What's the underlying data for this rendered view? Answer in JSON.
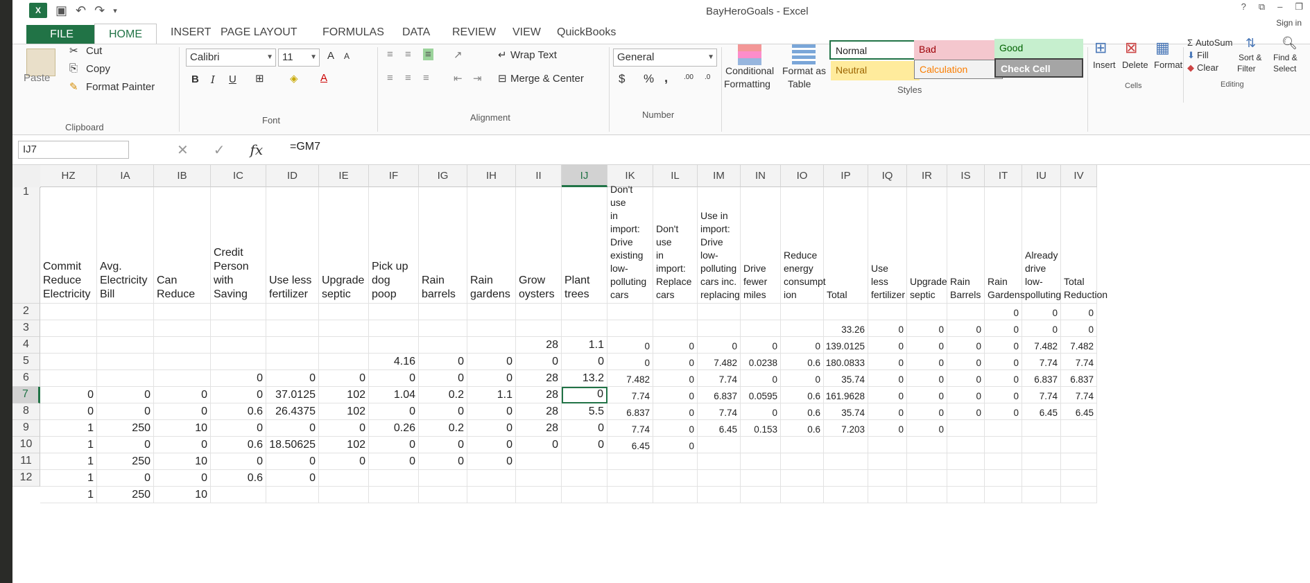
{
  "app": {
    "title": "BayHeroGoals - Excel",
    "sign_in": "Sign in",
    "logo": "X"
  },
  "tabs": [
    "FILE",
    "HOME",
    "INSERT",
    "PAGE LAYOUT",
    "FORMULAS",
    "DATA",
    "REVIEW",
    "VIEW",
    "QuickBooks"
  ],
  "ribbon": {
    "clipboard": {
      "paste": "Paste",
      "cut": "Cut",
      "copy": "Copy",
      "format_painter": "Format Painter",
      "group": "Clipboard"
    },
    "font": {
      "name": "Calibri",
      "size": "11",
      "bold": "B",
      "italic": "I",
      "underline": "U",
      "grow": "A",
      "shrink": "A",
      "font_color": "A",
      "group": "Font"
    },
    "alignment": {
      "wrap": "Wrap Text",
      "merge": "Merge & Center",
      "group": "Alignment"
    },
    "number": {
      "format": "General",
      "currency": "$",
      "percent": "%",
      "comma": ",",
      "inc_dec": ".00",
      "dec_dec": ".0",
      "group": "Number"
    },
    "styles": {
      "conditional": "Conditional",
      "conditional2": "Formatting",
      "format_table": "Format as",
      "format_table2": "Table",
      "normal": "Normal",
      "bad": "Bad",
      "good": "Good",
      "neutral": "Neutral",
      "calculation": "Calculation",
      "check_cell": "Check Cell",
      "group": "Styles"
    },
    "cells": {
      "insert": "Insert",
      "delete": "Delete",
      "format": "Format",
      "group": "Cells"
    },
    "editing": {
      "autosum": "AutoSum",
      "fill": "Fill",
      "clear": "Clear",
      "sort": "Sort &",
      "sort2": "Filter",
      "find": "Find &",
      "find2": "Select",
      "group": "Editing"
    }
  },
  "colors": {
    "accent": "#217346",
    "bad_bg": "#f4c7ce",
    "bad_fg": "#9c0006",
    "good_bg": "#c6efce",
    "good_fg": "#006100",
    "neutral_bg": "#ffeb9c",
    "neutral_fg": "#9c6500",
    "calc_bg": "#f2f2f2",
    "calc_fg": "#fa7d00",
    "check_bg": "#a5a5a5"
  },
  "formula_bar": {
    "name_box": "IJ7",
    "formula": "=GM7",
    "cancel": "✕",
    "enter": "✓",
    "fx": "fx"
  },
  "columns": [
    "HZ",
    "IA",
    "IB",
    "IC",
    "ID",
    "IE",
    "IF",
    "IG",
    "IH",
    "II",
    "IJ",
    "IK",
    "IL",
    "IM",
    "IN",
    "IO",
    "IP",
    "IQ",
    "IR",
    "IS",
    "IT",
    "IU",
    "IV"
  ],
  "rows": [
    "1",
    "2",
    "3",
    "4",
    "5",
    "6",
    "7",
    "8",
    "9",
    "10",
    "11",
    "12"
  ],
  "headers": [
    "Commit\nReduce\nElectricity",
    "Avg.\nElectricity\nBill",
    "Can\nReduce",
    "Credit\nPerson\nwith\nSaving",
    "Use less\nfertilizer",
    "Upgrade\nseptic",
    "Pick up\ndog poop",
    "Rain\nbarrels",
    "Rain\ngardens",
    "Grow\noysters",
    "Plant\ntrees",
    "Don't use\nin import:\nDrive\nexisting\nlow-\npolluting\ncars",
    "Don't use\nin import:\nReplace\ncars",
    "Use in\nimport:\nDrive low-\npolluting\ncars inc.\nreplacing",
    "Drive\nfewer\nmiles",
    "Reduce\nenergy\nconsumpt\nion",
    "Total",
    "Use less\nfertilizer",
    "Upgrade\nseptic",
    "Rain\nBarrels",
    "Rain\nGardens",
    "Already\ndrive low-\npolluting",
    "Total\nReduction"
  ],
  "cells": {
    "2": {
      "20": "0",
      "21": "0",
      "22": "0"
    },
    "3": {
      "16": "33.26",
      "17": "0",
      "18": "0",
      "19": "0",
      "20": "0",
      "21": "0",
      "22": "0"
    },
    "4": {
      "9": "28",
      "10": "1.1",
      "11": "0",
      "12": "0",
      "13": "0",
      "14": "0",
      "15": "0",
      "16": "139.0125",
      "17": "0",
      "18": "0",
      "19": "0",
      "20": "0",
      "21": "7.482",
      "22": "7.482"
    },
    "5": {
      "6": "4.16",
      "7": "0",
      "8": "0",
      "9": "0",
      "10": "0",
      "11": "0",
      "12": "0",
      "13": "7.482",
      "14": "0.0238",
      "15": "0.6",
      "16": "180.0833",
      "17": "0",
      "18": "0",
      "19": "0",
      "20": "0",
      "21": "7.74",
      "22": "7.74"
    },
    "6": {
      "3": "0",
      "4": "0",
      "5": "0",
      "6": "0",
      "7": "0",
      "8": "0",
      "9": "28",
      "10": "13.2",
      "11": "7.482",
      "12": "0",
      "13": "7.74",
      "14": "0",
      "15": "0",
      "16": "35.74",
      "17": "0",
      "18": "0",
      "19": "0",
      "20": "0",
      "21": "6.837",
      "22": "6.837"
    },
    "7": {
      "0": "0",
      "1": "0",
      "2": "0",
      "3": "0",
      "4": "37.0125",
      "5": "102",
      "6": "1.04",
      "7": "0.2",
      "8": "1.1",
      "9": "28",
      "10": "0",
      "11": "7.74",
      "12": "0",
      "13": "6.837",
      "14": "0.0595",
      "15": "0.6",
      "16": "161.9628",
      "17": "0",
      "18": "0",
      "19": "0",
      "20": "0",
      "21": "7.74",
      "22": "7.74"
    },
    "8": {
      "0": "0",
      "1": "0",
      "2": "0",
      "3": "0.6",
      "4": "26.4375",
      "5": "102",
      "6": "0",
      "7": "0",
      "8": "0",
      "9": "28",
      "10": "5.5",
      "11": "6.837",
      "12": "0",
      "13": "7.74",
      "14": "0",
      "15": "0.6",
      "16": "35.74",
      "17": "0",
      "18": "0",
      "19": "0",
      "20": "0",
      "21": "6.45",
      "22": "6.45"
    },
    "9": {
      "0": "1",
      "1": "250",
      "2": "10",
      "3": "0",
      "4": "0",
      "5": "0",
      "6": "0.26",
      "7": "0.2",
      "8": "0",
      "9": "28",
      "10": "0",
      "11": "7.74",
      "12": "0",
      "13": "6.45",
      "14": "0.153",
      "15": "0.6",
      "16": "7.203",
      "17": "0",
      "18": "0"
    },
    "10": {
      "0": "1",
      "1": "0",
      "2": "0",
      "3": "0.6",
      "4": "18.50625",
      "5": "102",
      "6": "0",
      "7": "0",
      "8": "0",
      "9": "0",
      "10": "0",
      "11": "6.45",
      "12": "0"
    },
    "11": {
      "0": "1",
      "1": "250",
      "2": "10",
      "3": "0",
      "4": "0",
      "5": "0",
      "6": "0",
      "7": "0",
      "8": "0"
    },
    "12": {
      "0": "1",
      "1": "0",
      "2": "0",
      "3": "0.6",
      "4": "0"
    },
    "13": {
      "0": "1",
      "1": "250",
      "2": "10"
    }
  },
  "active_cell": "IJ7"
}
